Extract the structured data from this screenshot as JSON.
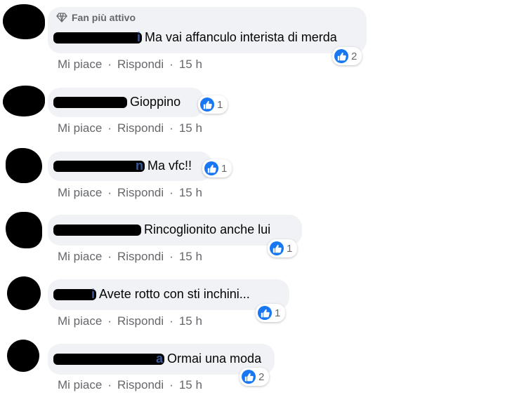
{
  "actions": {
    "like": "Mi piace",
    "reply": "Rispondi",
    "separator": "·"
  },
  "badge_label": "Fan più attivo",
  "comments": [
    {
      "author_visible": "i",
      "text": "Ma vai affanculo interista di merda",
      "reactions": "2",
      "time": "15 h"
    },
    {
      "author_visible": "",
      "text": "Gioppino",
      "reactions": "1",
      "time": "15 h"
    },
    {
      "author_visible": "n",
      "text": "Ma vfc!!",
      "reactions": "1",
      "time": "15 h"
    },
    {
      "author_visible": "",
      "text": "Rincoglionito anche lui",
      "reactions": "1",
      "time": "15 h"
    },
    {
      "author_visible": "i",
      "text": "Avete rotto con sti inchini...",
      "reactions": "1",
      "time": "15 h"
    },
    {
      "author_visible": "a",
      "text": "Ormai una moda",
      "reactions": "2",
      "time": "15 h"
    }
  ],
  "colors": {
    "bubble": "#f0f2f5",
    "author": "#385898",
    "like_blue": "#1877f2",
    "meta": "#65676b"
  },
  "icons": {
    "badge": "diamond-icon",
    "reaction": "thumbs-up-icon"
  }
}
